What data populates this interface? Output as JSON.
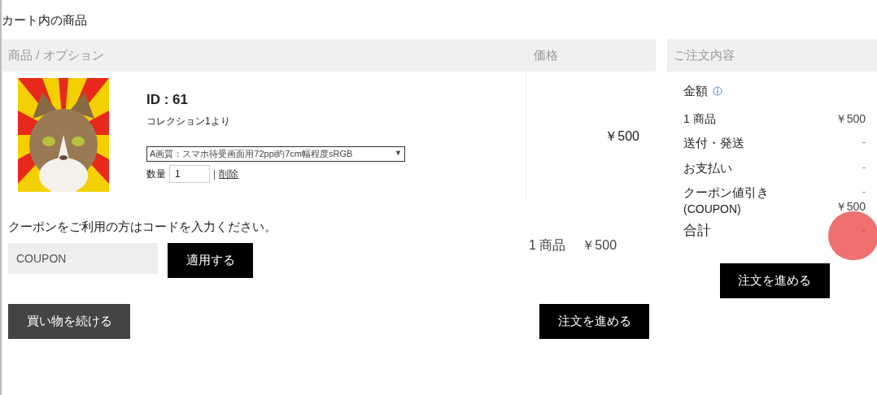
{
  "title": "カート内の商品",
  "cart": {
    "columns": [
      "商品 / オプション",
      "価格"
    ],
    "items": [
      {
        "id_label": "ID : 61",
        "collection": "コレクション1より",
        "option": "A画質：スマホ待受画面用72ppi約7cm幅程度sRGB",
        "option_arrow": "▼",
        "quantity_label": "数量",
        "quantity": "1",
        "separator": "|",
        "delete_link": "削除",
        "price": "￥500"
      }
    ],
    "coupon_prompt": "クーポンをご利用の方はコードを入力ください。",
    "coupon_placeholder": "COUPON",
    "apply_button": "適用する",
    "count": "1 商品",
    "subtotal": "￥500",
    "continue_button": "買い物を続ける",
    "checkout_button": "注文を進める"
  },
  "summary": {
    "title": "ご注文内容",
    "amount_label": "金額",
    "rows": [
      {
        "label": "1 商品",
        "value": "￥500"
      },
      {
        "label": "送付・発送",
        "value": "-"
      },
      {
        "label": "お支払い",
        "value": "-"
      },
      {
        "label": "クーポン値引き",
        "sublabel": "(COUPON)",
        "value": "-",
        "value2": "￥500"
      }
    ],
    "total_label": "合計",
    "total": "-",
    "checkout_button": "注文を進める"
  }
}
